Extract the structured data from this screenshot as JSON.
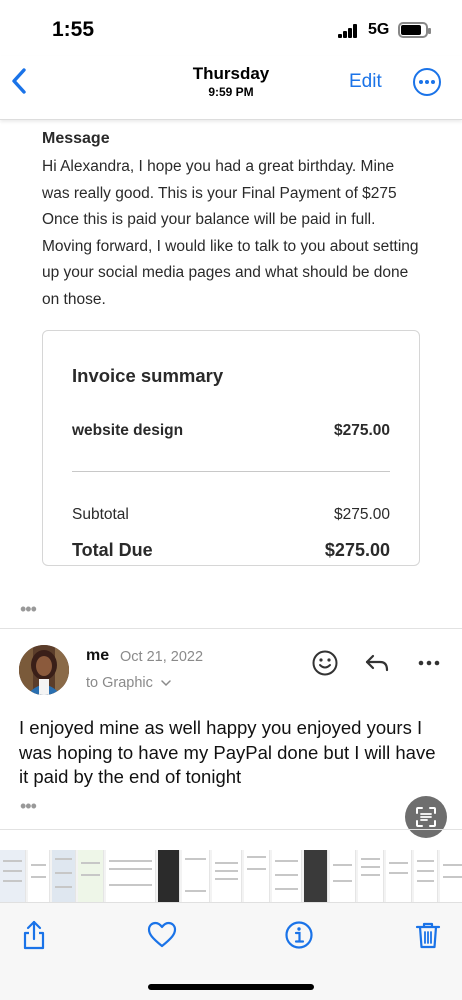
{
  "status_bar": {
    "time": "1:55",
    "network": "5G"
  },
  "nav": {
    "title": "Thursday",
    "subtitle": "9:59 PM",
    "edit_label": "Edit",
    "icons": [
      "chevron-left-icon",
      "more-circle-icon"
    ]
  },
  "message": {
    "heading": "Message",
    "body": "Hi Alexandra, I hope you had a great birthday. Mine was really good. This is your Final Payment of $275 Once this is paid your balance will be paid in full. Moving forward, I would like to talk to you about setting up your social media pages and what should be done on those."
  },
  "invoice": {
    "title": "Invoice summary",
    "item_label": "website design",
    "item_amount": "$275.00",
    "subtotal_label": "Subtotal",
    "subtotal_amount": "$275.00",
    "total_label": "Total Due",
    "total_amount": "$275.00"
  },
  "reply": {
    "sender": "me",
    "date": "Oct 21, 2022",
    "to": "to Graphic",
    "body": "I enjoyed mine as well happy you enjoyed yours I was hoping to have my PayPal done but I will have it paid by the end of tonight",
    "icons": [
      "emoji-icon",
      "reply-icon",
      "more-icon"
    ]
  },
  "ellipsis": "•••",
  "toolbar": {
    "icons": [
      "share-icon",
      "heart-icon",
      "info-icon",
      "trash-icon"
    ]
  },
  "colors": {
    "accent": "#1a73e8",
    "text": "#2a2a2a",
    "muted": "#8a8a8a"
  }
}
